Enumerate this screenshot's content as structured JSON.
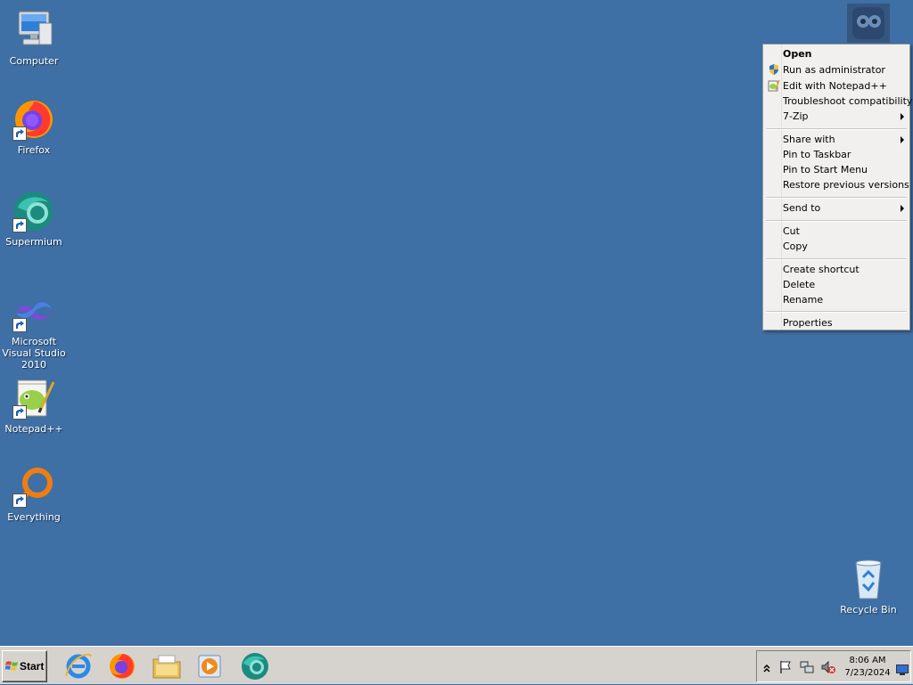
{
  "desktop": {
    "icons": [
      {
        "label": "Computer",
        "icon": "computer-icon"
      },
      {
        "label": "Firefox",
        "icon": "firefox-icon"
      },
      {
        "label": "Supermium",
        "icon": "supermium-icon"
      },
      {
        "label": "Microsoft Visual Studio 2010",
        "icon": "visual-studio-icon"
      },
      {
        "label": "Notepad++",
        "icon": "notepadpp-icon"
      },
      {
        "label": "Everything",
        "icon": "everything-icon"
      },
      {
        "label": "Recycle Bin",
        "icon": "recycle-bin-icon"
      }
    ],
    "background_color": "#3e6fa5"
  },
  "context_menu": {
    "items": [
      {
        "label": "Open"
      },
      {
        "label": "Run as administrator",
        "icon": "uac-shield-icon"
      },
      {
        "label": "Edit with Notepad++",
        "icon": "notepadpp-icon"
      },
      {
        "label": "Troubleshoot compatibility"
      },
      {
        "label": "7-Zip",
        "submenu": true
      },
      {
        "label": "Share with",
        "submenu": true
      },
      {
        "label": "Pin to Taskbar"
      },
      {
        "label": "Pin to Start Menu"
      },
      {
        "label": "Restore previous versions"
      },
      {
        "label": "Send to",
        "submenu": true
      },
      {
        "label": "Cut"
      },
      {
        "label": "Copy"
      },
      {
        "label": "Create shortcut"
      },
      {
        "label": "Delete"
      },
      {
        "label": "Rename"
      },
      {
        "label": "Properties"
      }
    ]
  },
  "taskbar": {
    "start_label": "Start",
    "pinned": [
      "internet-explorer-icon",
      "firefox-icon",
      "file-explorer-icon",
      "media-player-icon",
      "supermium-icon"
    ],
    "tray": {
      "icons": [
        "show-hidden-icons-chevron",
        "action-center-flag-icon",
        "network-icon",
        "volume-muted-icon",
        "show-desktop-icon"
      ],
      "time": "8:06 AM",
      "date": "7/23/2024"
    }
  }
}
